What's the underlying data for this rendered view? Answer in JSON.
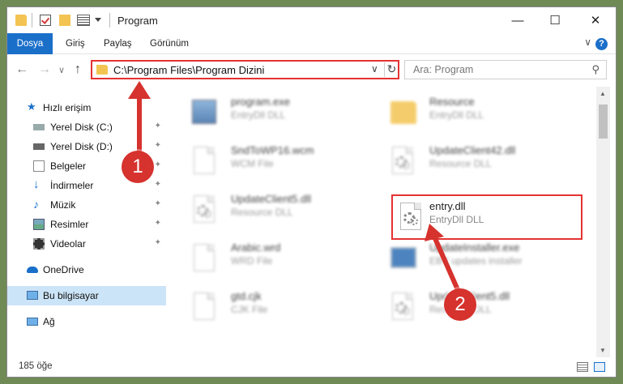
{
  "window": {
    "title": "Program",
    "min_icon": "—",
    "max_icon": "☐",
    "close_icon": "✕"
  },
  "ribbon": {
    "tabs": [
      "Dosya",
      "Giriş",
      "Paylaş",
      "Görünüm"
    ],
    "expand_icon": "∨",
    "help_icon": "?"
  },
  "nav": {
    "back_icon": "←",
    "forward_icon": "→",
    "recent_icon": "∨",
    "up_icon": "↑",
    "address": "C:\\Program Files\\Program Dizini",
    "address_chevron": "∨",
    "refresh_icon": "↻",
    "search_placeholder": "Ara: Program",
    "search_icon": "⚲"
  },
  "sidebar": {
    "quick_access": "Hızlı erişim",
    "items": [
      {
        "label": "Yerel Disk (C:)",
        "icon": "drive-icon"
      },
      {
        "label": "Yerel Disk (D:)",
        "icon": "drive-icon"
      },
      {
        "label": "Belgeler",
        "icon": "documents-icon"
      },
      {
        "label": "İndirmeler",
        "icon": "downloads-icon"
      },
      {
        "label": "Müzik",
        "icon": "music-icon"
      },
      {
        "label": "Resimler",
        "icon": "pictures-icon"
      },
      {
        "label": "Videolar",
        "icon": "videos-icon"
      }
    ],
    "pin_icon": "📌",
    "onedrive": "OneDrive",
    "this_pc": "Bu bilgisayar",
    "network": "Ağ"
  },
  "files": [
    {
      "name": "program.exe",
      "type": "EntryDll DLL",
      "icon": "exe"
    },
    {
      "name": "Resource",
      "type": "EntryDll DLL",
      "icon": "folder"
    },
    {
      "name": "SndToWP16.wcm",
      "type": "WCM File",
      "icon": "doc"
    },
    {
      "name": "UpdateClient42.dll",
      "type": "Resource DLL",
      "icon": "dll"
    },
    {
      "name": "UpdateClient5.dll",
      "type": "Resource DLL",
      "icon": "dll"
    },
    {
      "name": "entry.dll",
      "type": "EntryDll DLL",
      "icon": "dll"
    },
    {
      "name": "Arabic.wrd",
      "type": "WRD File",
      "icon": "doc"
    },
    {
      "name": "UpdateInstaller.exe",
      "type": "EBY updates installer",
      "icon": "installer"
    },
    {
      "name": "gtd.cjk",
      "type": "CJK File",
      "icon": "doc"
    },
    {
      "name": "UpdateClient5.dll",
      "type": "Resource DLL",
      "icon": "dll"
    }
  ],
  "status": {
    "count": "185 öğe"
  },
  "callouts": [
    "1",
    "2"
  ],
  "colors": {
    "accent": "#1a6fc9",
    "highlight": "#e53232",
    "callout": "#d6322e",
    "folder": "#f3c452",
    "selected": "#cce4f7"
  }
}
